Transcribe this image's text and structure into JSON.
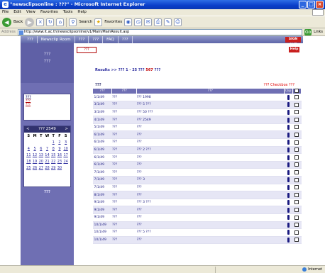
{
  "window": {
    "title": "\"newsclipsonline : ???\" - Microsoft Internet Explorer",
    "controls": {
      "minimize": "_",
      "maximize": "□",
      "close": "×"
    }
  },
  "menu": {
    "items": [
      "File",
      "Edit",
      "View",
      "Favorites",
      "Tools",
      "Help"
    ]
  },
  "toolbar": {
    "back_label": "Back",
    "search_label": "Search",
    "favorites_label": "Favorites"
  },
  "address": {
    "label": "Address",
    "url": "http://www.it.ac.th/newsclipsonline/v1/Main/MainResult.asp",
    "go": "Go",
    "links": "Links"
  },
  "site_nav": {
    "items": [
      "???",
      "Newsclip Room",
      "???",
      "???",
      "FAQ",
      "???"
    ],
    "signout": "SIGN OUT"
  },
  "sidebar": {
    "title_top": "???",
    "title_sub": "???",
    "box_head": "???",
    "box_sub": "???",
    "box_link": "???",
    "more_link": "???"
  },
  "calendar": {
    "prev": "<",
    "month_label": "??? 2549",
    "next": ">",
    "dow": [
      "S",
      "M",
      "T",
      "W",
      "T",
      "F",
      "S"
    ],
    "days": [
      {
        "d": "",
        "other": true
      },
      {
        "d": "",
        "other": true
      },
      {
        "d": "",
        "other": true
      },
      {
        "d": "",
        "other": true
      },
      {
        "d": "1",
        "other": false
      },
      {
        "d": "2",
        "other": false
      },
      {
        "d": "3",
        "other": false
      },
      {
        "d": "4",
        "other": false
      },
      {
        "d": "5",
        "other": false
      },
      {
        "d": "6",
        "other": false
      },
      {
        "d": "7",
        "other": false
      },
      {
        "d": "8",
        "other": false
      },
      {
        "d": "9",
        "other": false
      },
      {
        "d": "10",
        "other": false
      },
      {
        "d": "11",
        "other": false
      },
      {
        "d": "12",
        "other": false
      },
      {
        "d": "13",
        "other": false
      },
      {
        "d": "14",
        "other": false
      },
      {
        "d": "15",
        "other": false
      },
      {
        "d": "16",
        "other": false
      },
      {
        "d": "17",
        "other": false
      },
      {
        "d": "18",
        "other": false
      },
      {
        "d": "19",
        "other": false
      },
      {
        "d": "20",
        "other": false
      },
      {
        "d": "21",
        "other": false
      },
      {
        "d": "22",
        "other": false
      },
      {
        "d": "23",
        "other": false
      },
      {
        "d": "24",
        "other": false
      },
      {
        "d": "25",
        "other": false
      },
      {
        "d": "26",
        "other": false
      },
      {
        "d": "27",
        "other": false
      },
      {
        "d": "28",
        "other": false
      },
      {
        "d": "29",
        "other": false
      },
      {
        "d": "30",
        "other": false
      },
      {
        "d": "",
        "other": true
      }
    ]
  },
  "main": {
    "back_button": "???",
    "help_button": "Help",
    "results_prefix": "Results >> ??? 1 - 25 ??? ",
    "results_count": "567",
    "results_suffix": " ???",
    "filter_label": "???",
    "hint": "??? Checkbox ???"
  },
  "table": {
    "headers": [
      "???",
      "???",
      "???",
      "Clip",
      ""
    ],
    "rows": [
      {
        "date": "1/1/49",
        "sender": "???",
        "subject": "??? 1998"
      },
      {
        "date": "3/1/49",
        "sender": "???",
        "subject": "??? 5 ???"
      },
      {
        "date": "3/1/49",
        "sender": "???",
        "subject": "??? 50 ???"
      },
      {
        "date": "4/1/49",
        "sender": "???",
        "subject": "??? 2549"
      },
      {
        "date": "5/1/49",
        "sender": "???",
        "subject": "???"
      },
      {
        "date": "6/1/49",
        "sender": "???",
        "subject": "???"
      },
      {
        "date": "6/1/49",
        "sender": "???",
        "subject": "???"
      },
      {
        "date": "6/1/49",
        "sender": "???",
        "subject": "??? 2 ???"
      },
      {
        "date": "6/1/49",
        "sender": "???",
        "subject": "???"
      },
      {
        "date": "6/1/49",
        "sender": "???",
        "subject": "???"
      },
      {
        "date": "7/1/49",
        "sender": "???",
        "subject": "???"
      },
      {
        "date": "7/1/49",
        "sender": "???",
        "subject": "??? 3"
      },
      {
        "date": "7/1/49",
        "sender": "???",
        "subject": "???"
      },
      {
        "date": "8/1/49",
        "sender": "???",
        "subject": "???"
      },
      {
        "date": "9/1/49",
        "sender": "???",
        "subject": "??? 3 ???"
      },
      {
        "date": "9/1/49",
        "sender": "???",
        "subject": "???"
      },
      {
        "date": "9/1/49",
        "sender": "???",
        "subject": "???"
      },
      {
        "date": "10/1/49",
        "sender": "???",
        "subject": "???"
      },
      {
        "date": "10/1/49",
        "sender": "???",
        "subject": "??? 5 ???"
      },
      {
        "date": "10/1/49",
        "sender": "???",
        "subject": "???"
      }
    ]
  },
  "status": {
    "zone": "Internet"
  },
  "colors": {
    "accent": "#6f6fb3",
    "sidebar": "#6f6fb3",
    "danger": "#c9201f",
    "link": "#2b2b9e"
  }
}
